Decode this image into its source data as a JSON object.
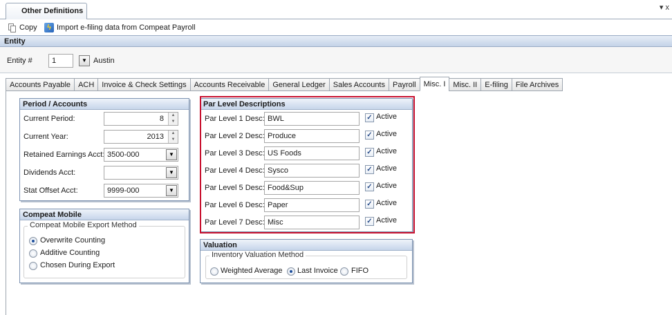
{
  "document_tab": {
    "title": "Other Definitions",
    "menu_glyph": "▾ x"
  },
  "toolbar": {
    "copy_label": "Copy",
    "import_label": "Import e-filing data from Compeat Payroll"
  },
  "entity": {
    "section_title": "Entity",
    "label": "Entity #",
    "number": "1",
    "name": "Austin"
  },
  "tabs": [
    {
      "label": "Accounts Payable",
      "active": false
    },
    {
      "label": "ACH",
      "active": false
    },
    {
      "label": "Invoice & Check Settings",
      "active": false
    },
    {
      "label": "Accounts Receivable",
      "active": false
    },
    {
      "label": "General Ledger",
      "active": false
    },
    {
      "label": "Sales Accounts",
      "active": false
    },
    {
      "label": "Payroll",
      "active": false
    },
    {
      "label": "Misc. I",
      "active": true
    },
    {
      "label": "Misc. II",
      "active": false
    },
    {
      "label": "E-filing",
      "active": false
    },
    {
      "label": "File Archives",
      "active": false
    }
  ],
  "period_accounts": {
    "title": "Period / Accounts",
    "current_period": {
      "label": "Current Period:",
      "value": "8"
    },
    "current_year": {
      "label": "Current Year:",
      "value": "2013"
    },
    "retained_earnings": {
      "label": "Retained Earnings Acct:",
      "value": "3500-000"
    },
    "dividends": {
      "label": "Dividends Acct:",
      "value": ""
    },
    "stat_offset": {
      "label": "Stat Offset Acct:",
      "value": "9999-000"
    }
  },
  "compeat_mobile": {
    "title": "Compeat Mobile",
    "group_label": "Compeat Mobile Export Method",
    "options": [
      {
        "label": "Overwrite Counting",
        "checked": true
      },
      {
        "label": "Additive Counting",
        "checked": false
      },
      {
        "label": "Chosen During Export",
        "checked": false
      }
    ]
  },
  "par_levels": {
    "title": "Par Level Descriptions",
    "active_label": "Active",
    "highlight_color": "#c8102e",
    "rows": [
      {
        "label": "Par Level 1 Desc:",
        "value": "BWL",
        "active": true
      },
      {
        "label": "Par Level 2 Desc:",
        "value": "Produce",
        "active": true
      },
      {
        "label": "Par Level 3 Desc:",
        "value": "US Foods",
        "active": true
      },
      {
        "label": "Par Level 4 Desc:",
        "value": "Sysco",
        "active": true
      },
      {
        "label": "Par Level 5 Desc:",
        "value": "Food&Sup",
        "active": true
      },
      {
        "label": "Par Level 6 Desc:",
        "value": "Paper",
        "active": true
      },
      {
        "label": "Par Level 7 Desc:",
        "value": "Misc",
        "active": true
      }
    ]
  },
  "valuation": {
    "title": "Valuation",
    "group_label": "Inventory Valuation Method",
    "options": [
      {
        "label": "Weighted Average",
        "checked": false
      },
      {
        "label": "Last Invoice",
        "checked": true
      },
      {
        "label": "FIFO",
        "checked": false
      }
    ]
  },
  "icons": {
    "copy": "copy-icon",
    "import": "lightning-bolt-icon",
    "dropdown": "chevron-down-icon",
    "spin": "spin-arrows-icon",
    "checkbox_check": "checkmark-icon"
  }
}
